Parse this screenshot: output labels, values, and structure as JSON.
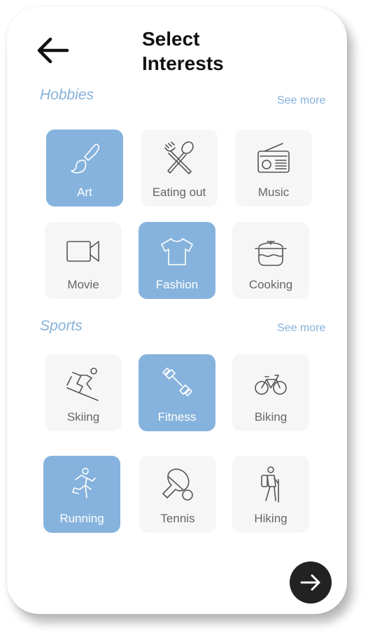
{
  "header": {
    "title_line1": "Select",
    "title_line2": "Interests",
    "back_icon": "arrow-left-icon"
  },
  "sections": [
    {
      "title": "Hobbies",
      "see_more": "See more",
      "tiles": [
        {
          "label": "Art",
          "icon": "paintbrush-icon",
          "selected": true
        },
        {
          "label": "Eating out",
          "icon": "fork-spoon-icon",
          "selected": false
        },
        {
          "label": "Music",
          "icon": "radio-icon",
          "selected": false
        },
        {
          "label": "Movie",
          "icon": "video-camera-icon",
          "selected": false
        },
        {
          "label": "Fashion",
          "icon": "t-shirt-icon",
          "selected": true
        },
        {
          "label": "Cooking",
          "icon": "cooking-pot-icon",
          "selected": false
        }
      ]
    },
    {
      "title": "Sports",
      "see_more": "See more",
      "tiles": [
        {
          "label": "Skiing",
          "icon": "skier-icon",
          "selected": false
        },
        {
          "label": "Fitness",
          "icon": "dumbbell-icon",
          "selected": true
        },
        {
          "label": "Biking",
          "icon": "bicycle-icon",
          "selected": false
        },
        {
          "label": "Running",
          "icon": "runner-icon",
          "selected": true
        },
        {
          "label": "Tennis",
          "icon": "paddle-ball-icon",
          "selected": false
        },
        {
          "label": "Hiking",
          "icon": "hiker-icon",
          "selected": false
        }
      ]
    }
  ],
  "footer": {
    "next_icon": "arrow-right-icon"
  },
  "colors": {
    "accent": "#86b3dd",
    "tile_bg": "#f6f6f6",
    "section_title": "#85b1da",
    "next_button": "#222222"
  }
}
